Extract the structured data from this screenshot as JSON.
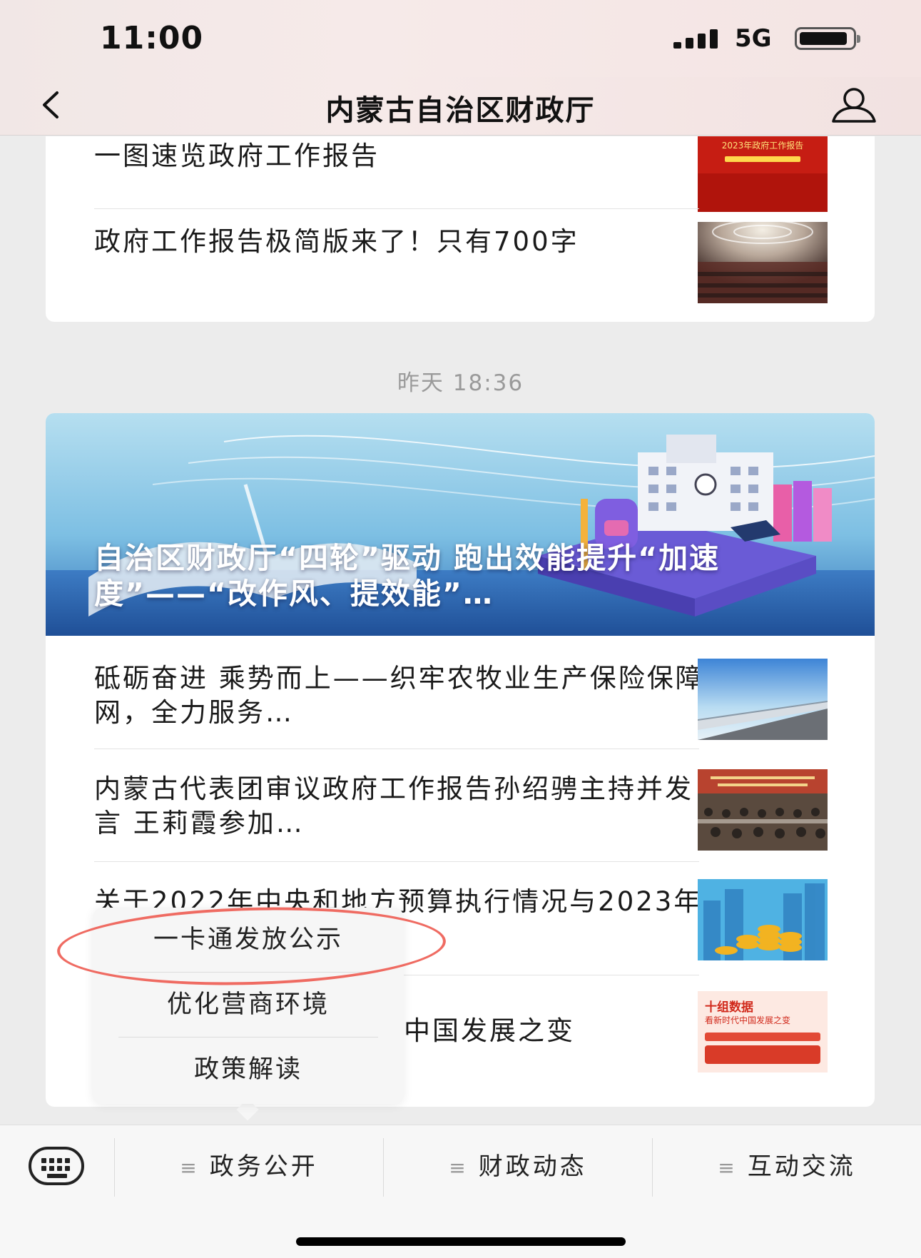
{
  "status_bar": {
    "time": "11:00",
    "network": "5G"
  },
  "nav": {
    "title": "内蒙古自治区财政厅"
  },
  "feed_top": {
    "items": [
      {
        "title": "一图速览政府工作报告",
        "thumb_caption": "2023年政府工作报告"
      },
      {
        "title": "政府工作报告极简版来了！只有700字"
      }
    ]
  },
  "timestamp": "昨天 18:36",
  "feed_main": {
    "banner_title": "自治区财政厅“四轮”驱动 跑出效能提升“加速度”——“改作风、提效能”…",
    "items": [
      {
        "title": "砥砺奋进 乘势而上——织牢农牧业生产保险保障网，全力服务…"
      },
      {
        "title": "内蒙古代表团审议政府工作报告孙绍骋主持并发言 王莉霞参加…"
      },
      {
        "title": "关于2022年中央和地方预算执行情况与2023年中央和地方预算…"
      },
      {
        "title": "十组数据看新时代中国发展之变",
        "visible_title": "中国发展之变",
        "thumb_caption": "十组数据",
        "thumb_subcaption": "看新时代中国发展之变"
      }
    ]
  },
  "popup_menu": {
    "items": [
      "一卡通发放公示",
      "优化营商环境",
      "政策解读"
    ]
  },
  "bottom_menu": {
    "tabs": [
      "政务公开",
      "财政动态",
      "互动交流"
    ]
  },
  "colors": {
    "header_bg": "#f3e7e6",
    "highlight_ring": "#ef6b62",
    "card_bg": "#ffffff",
    "page_bg": "#ececec"
  },
  "icons": [
    "back-arrow-icon",
    "profile-icon",
    "keyboard-icon",
    "menu-hamburger-icon"
  ]
}
